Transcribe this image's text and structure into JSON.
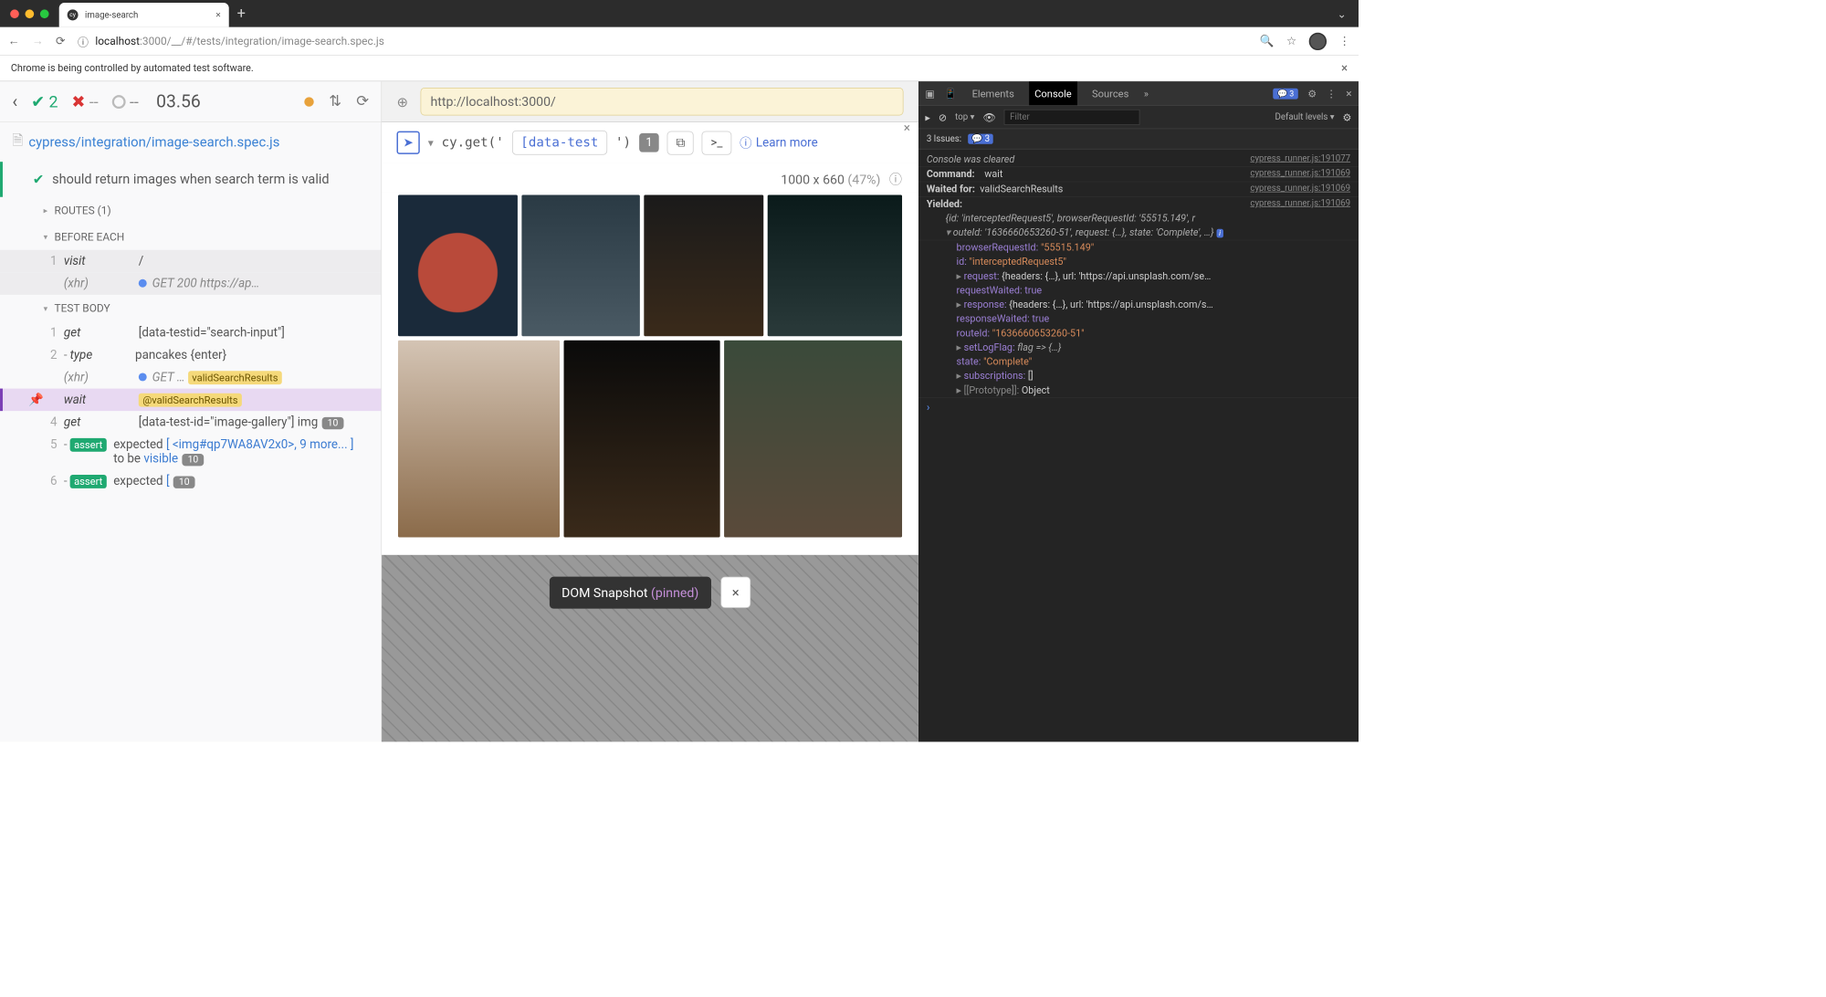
{
  "browser": {
    "tab_title": "image-search",
    "url_host": "localhost",
    "url_port_path": ":3000/__/#/tests/integration/image-search.spec.js",
    "infobar": "Chrome is being controlled by automated test software."
  },
  "reporter": {
    "pass_count": "2",
    "fail_count": "--",
    "pending_count": "--",
    "duration": "03.56",
    "spec_file": "cypress/integration/image-search.spec.js",
    "test_title": "should return images when search term is valid",
    "routes_header": "ROUTES (1)",
    "before_each_header": "BEFORE EACH",
    "test_body_header": "TEST BODY",
    "cmds": {
      "c1_num": "1",
      "c1_name": "visit",
      "c1_val": "/",
      "c1b_name": "(xhr)",
      "c1b_val": "GET 200 https://ap…",
      "c2_num": "1",
      "c2_name": "get",
      "c2_val": "[data-testid=\"search-input\"]",
      "c3_num": "2",
      "c3_name": "type",
      "c3_val": "pancakes {enter}",
      "c3b_name": "(xhr)",
      "c3b_val": "GET …",
      "c3b_alias": "validSearchResults",
      "c4_name": "wait",
      "c4_val": "@validSearchResults",
      "c5_num": "4",
      "c5_name": "get",
      "c5_val": "[data-test-id=\"image-gallery\"] img",
      "c5_count": "10",
      "c6_num": "5",
      "c6_assert": "assert",
      "c6_count": "10",
      "c6_val_a": "expected",
      "c6_val_b": "[ <img#qp7WA8AV2x0>, 9 more... ]",
      "c6_val_c": "to be",
      "c6_val_d": "visible",
      "c7_num": "6",
      "c7_assert": "assert",
      "c7_count": "10",
      "c7_val_a": "expected",
      "c7_val_b": "["
    }
  },
  "aut": {
    "url": "http://localhost:3000/",
    "cy_prefix": "cy.get('",
    "selector": "[data-test",
    "cy_suffix": "')",
    "match_count": "1",
    "learn_more": "Learn more",
    "dimensions": "1000 x 660",
    "scale": "(47%)",
    "snapshot_label": "DOM Snapshot",
    "snapshot_pinned": "(pinned)"
  },
  "devtools": {
    "tabs": {
      "elements": "Elements",
      "console": "Console",
      "sources": "Sources"
    },
    "msg_count": "3",
    "filter_top": "top",
    "filter_placeholder": "Filter",
    "levels": "Default levels",
    "issues": "3 Issues:",
    "issues_count": "3",
    "log": {
      "l1": "Console was cleared",
      "s1": "cypress_runner.js:191077",
      "l2a": "Command:",
      "l2b": "wait",
      "s2": "cypress_runner.js:191069",
      "l3a": "Waited for:",
      "l3b": "validSearchResults",
      "s3": "cypress_runner.js:191069",
      "l4a": "Yielded:",
      "s4": "cypress_runner.js:191069",
      "l4b": "{id: 'interceptedRequest5', browserRequestId: '55515.149', r",
      "l5": "outeId: '1636660653260-51', request: {…}, state: 'Complete', …}",
      "p1k": "browserRequestId:",
      "p1v": "\"55515.149\"",
      "p2k": "id:",
      "p2v": "\"interceptedRequest5\"",
      "p3k": "request:",
      "p3v": "{headers: {…}, url: 'https://api.unsplash.com/se…",
      "p4k": "requestWaited:",
      "p4v": "true",
      "p5k": "response:",
      "p5v": "{headers: {…}, url: 'https://api.unsplash.com/s…",
      "p6k": "responseWaited:",
      "p6v": "true",
      "p7k": "routeId:",
      "p7v": "\"1636660653260-51\"",
      "p8k": "setLogFlag:",
      "p8v": "flag => {…}",
      "p9k": "state:",
      "p9v": "\"Complete\"",
      "p10k": "subscriptions:",
      "p10v": "[]",
      "p11k": "[[Prototype]]:",
      "p11v": "Object"
    }
  }
}
